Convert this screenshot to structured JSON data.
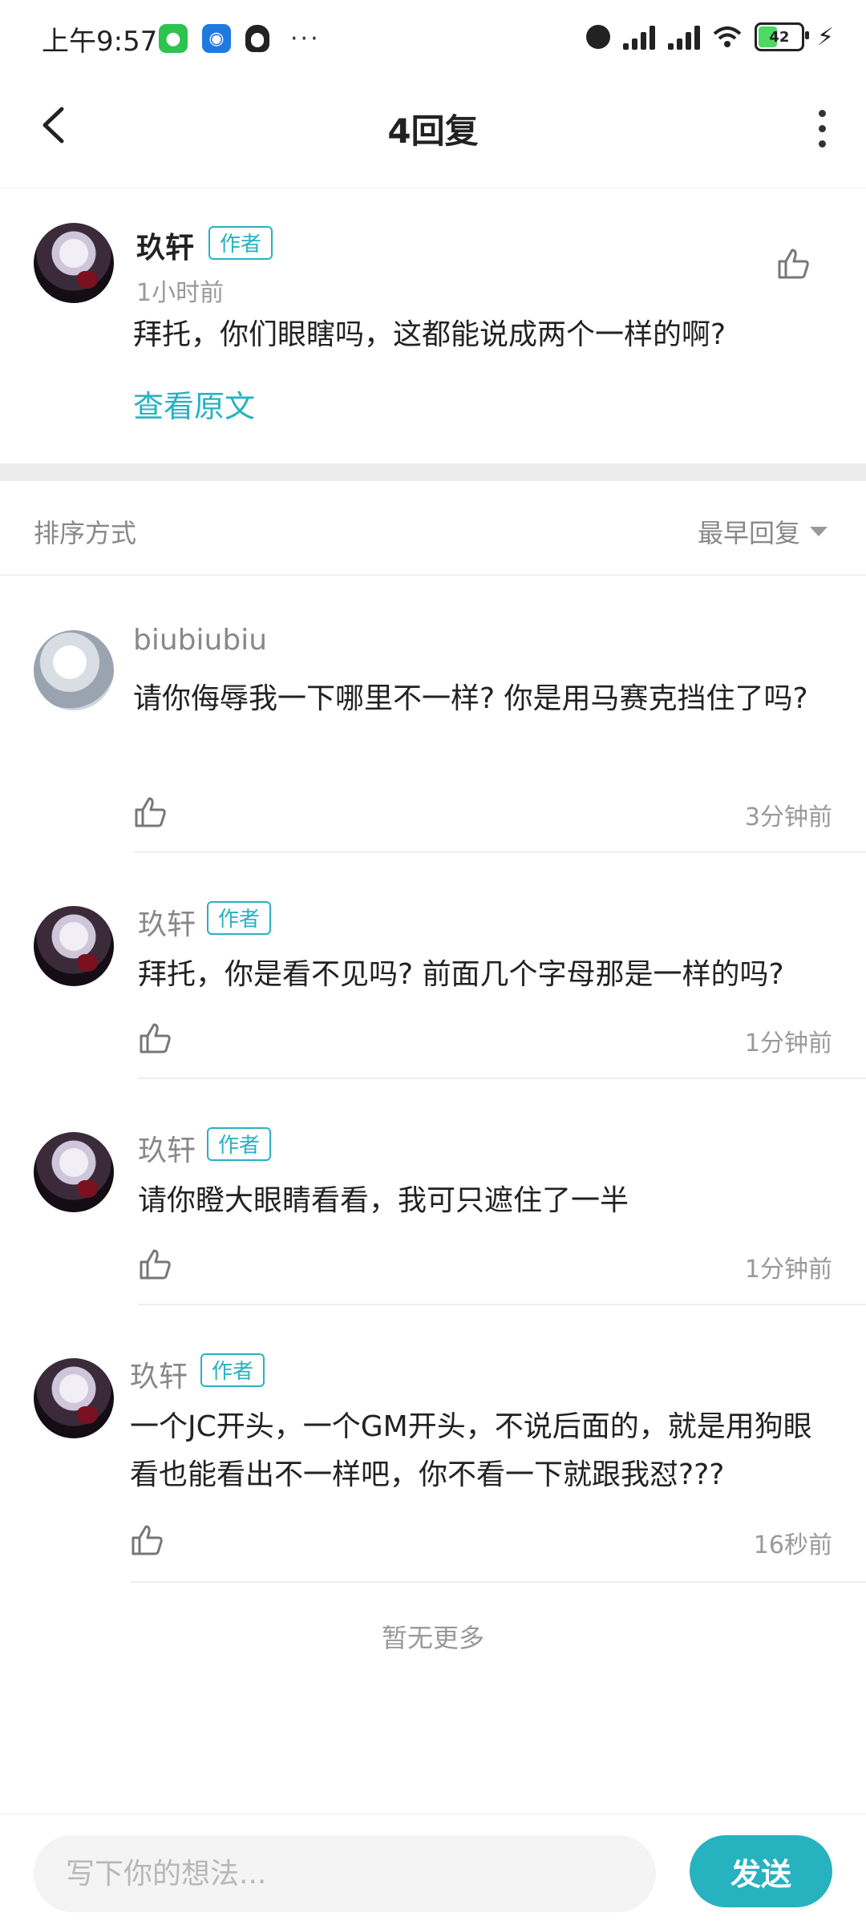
{
  "status_bar": {
    "time": "上午9:57",
    "notification_icons": [
      "wechat-icon",
      "app-icon",
      "qq-icon"
    ],
    "more_dots": "···",
    "battery_level": "42",
    "battery_fraction": 0.42
  },
  "header": {
    "title": "4回复",
    "back_icon": "chevron-left-icon",
    "more_icon": "more-vertical-icon"
  },
  "original_comment": {
    "author": "玖轩",
    "badge": "作者",
    "time": "1小时前",
    "text": "拜托，你们眼瞎吗，这都能说成两个一样的啊?",
    "view_original_label": "查看原文"
  },
  "sort": {
    "label": "排序方式",
    "selected": "最早回复"
  },
  "replies": [
    {
      "author": "biubiubiu",
      "badge": "",
      "text": "请你侮辱我一下哪里不一样? 你是用马赛克挡住了吗?",
      "time": "3分钟前"
    },
    {
      "author": "玖轩",
      "badge": "作者",
      "text": "拜托，你是看不见吗? 前面几个字母那是一样的吗?",
      "time": "1分钟前"
    },
    {
      "author": "玖轩",
      "badge": "作者",
      "text": "请你瞪大眼睛看看，我可只遮住了一半",
      "time": "1分钟前"
    },
    {
      "author": "玖轩",
      "badge": "作者",
      "text": "一个JC开头，一个GM开头，不说后面的，就是用狗眼看也能看出不一样吧，你不看一下就跟我怼???",
      "time": "16秒前"
    }
  ],
  "footer_text": "暂无更多",
  "composer": {
    "placeholder": "写下你的想法...",
    "send_label": "发送"
  },
  "colors": {
    "accent": "#27b2c0",
    "divider": "#ececec",
    "muted_text": "#999999"
  }
}
